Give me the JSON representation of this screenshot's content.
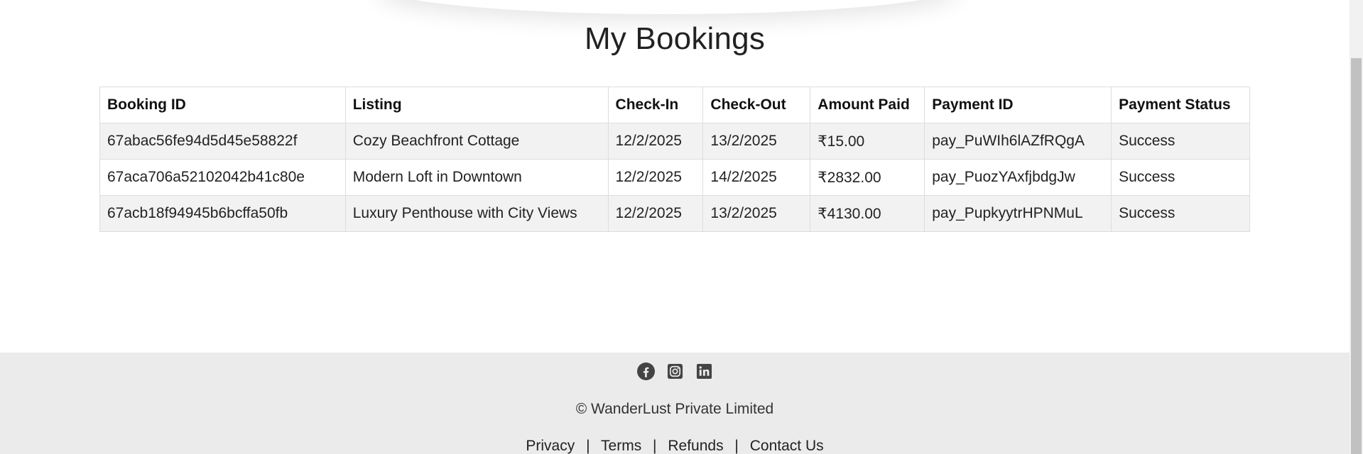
{
  "page": {
    "title": "My Bookings"
  },
  "table": {
    "headers": [
      "Booking ID",
      "Listing",
      "Check-In",
      "Check-Out",
      "Amount Paid",
      "Payment ID",
      "Payment Status"
    ],
    "rows": [
      [
        "67abac56fe94d5d45e58822f",
        "Cozy Beachfront Cottage",
        "12/2/2025",
        "13/2/2025",
        "₹15.00",
        "pay_PuWIh6lAZfRQgA",
        "Success"
      ],
      [
        "67aca706a52102042b41c80e",
        "Modern Loft in Downtown",
        "12/2/2025",
        "14/2/2025",
        "₹2832.00",
        "pay_PuozYAxfjbdgJw",
        "Success"
      ],
      [
        "67acb18f94945b6bcffa50fb",
        "Luxury Penthouse with City Views",
        "12/2/2025",
        "13/2/2025",
        "₹4130.00",
        "pay_PupkyytrHPNMuL",
        "Success"
      ]
    ]
  },
  "footer": {
    "socials": [
      {
        "name": "facebook-icon"
      },
      {
        "name": "instagram-icon"
      },
      {
        "name": "linkedin-icon"
      }
    ],
    "copyright": "© WanderLust Private Limited",
    "links": [
      "Privacy",
      "Terms",
      "Refunds",
      "Contact Us"
    ],
    "separator": "|"
  },
  "colors": {
    "footer_bg": "#ebebeb",
    "row_stripe": "#f2f2f2",
    "border": "#dddddd",
    "icon": "#444444"
  }
}
